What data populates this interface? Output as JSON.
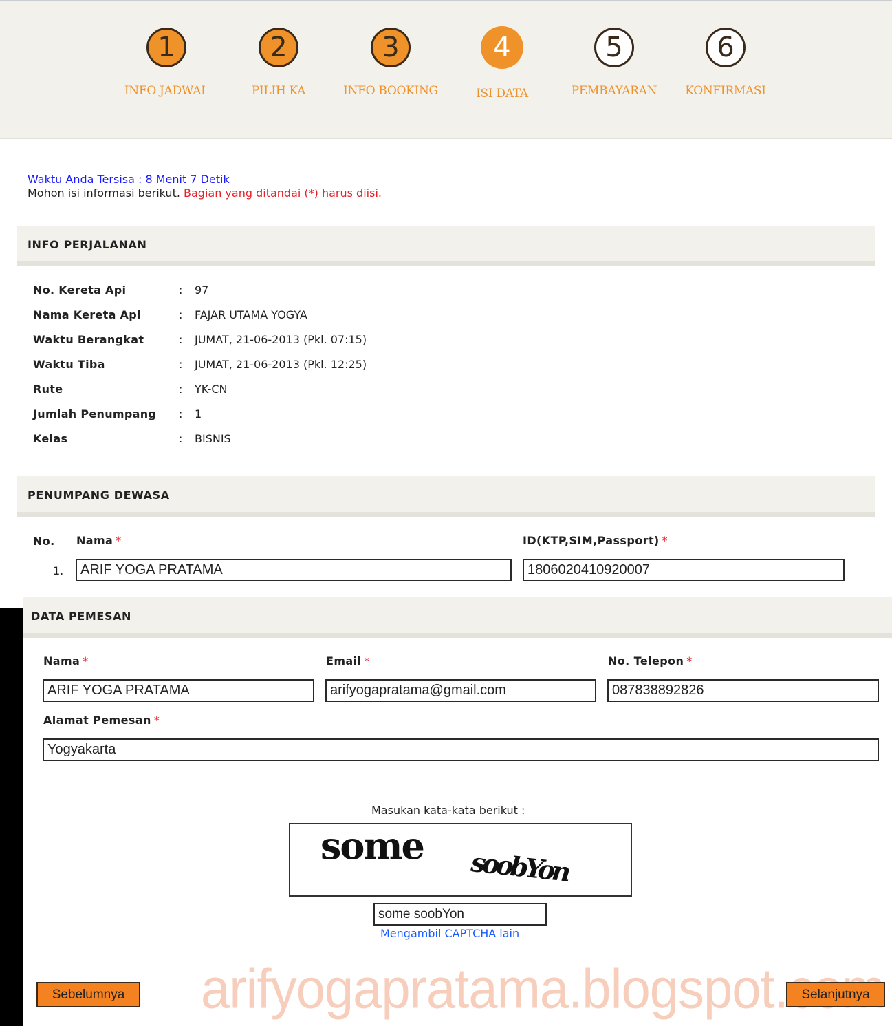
{
  "steps": [
    {
      "number": "1",
      "label": "INFO JADWAL",
      "state": "done"
    },
    {
      "number": "2",
      "label": "PILIH KA",
      "state": "done"
    },
    {
      "number": "3",
      "label": "INFO BOOKING",
      "state": "done"
    },
    {
      "number": "4",
      "label": "ISI DATA",
      "state": "active"
    },
    {
      "number": "5",
      "label": "PEMBAYARAN",
      "state": "todo"
    },
    {
      "number": "6",
      "label": "KONFIRMASI",
      "state": "todo"
    }
  ],
  "timer": "Waktu Anda Tersisa : 8 Menit 7 Detik",
  "notice": {
    "text": "Mohon isi informasi berikut. ",
    "required_text": "Bagian yang ditandai (*) harus diisi."
  },
  "trip_info": {
    "title": "INFO PERJALANAN",
    "rows": [
      {
        "label": "No. Kereta Api",
        "sep": ":",
        "value": "97"
      },
      {
        "label": "Nama Kereta Api",
        "sep": ":",
        "value": "FAJAR UTAMA YOGYA"
      },
      {
        "label": "Waktu Berangkat",
        "sep": ":",
        "value": "JUMAT, 21-06-2013 (Pkl. 07:15)"
      },
      {
        "label": "Waktu Tiba",
        "sep": ":",
        "value": "JUMAT, 21-06-2013 (Pkl. 12:25)"
      },
      {
        "label": "Rute",
        "sep": ":",
        "value": "YK-CN"
      },
      {
        "label": "Jumlah Penumpang",
        "sep": ":",
        "value": "1"
      },
      {
        "label": "Kelas",
        "sep": ":",
        "value": "BISNIS"
      }
    ]
  },
  "adult_passenger": {
    "title": "PENUMPANG DEWASA",
    "col_no": "No.",
    "col_name": "Nama",
    "col_id": "ID(KTP,SIM,Passport)",
    "required_mark": "*",
    "row_no": "1.",
    "name_value": "ARIF YOGA PRATAMA",
    "id_value": "1806020410920007"
  },
  "booker": {
    "title": "DATA PEMESAN",
    "name_label": "Nama",
    "email_label": "Email",
    "phone_label": "No. Telepon",
    "address_label": "Alamat Pemesan",
    "required_mark": "*",
    "name_value": "ARIF YOGA PRATAMA",
    "email_value": "arifyogapratama@gmail.com",
    "phone_value": "087838892826",
    "address_value": "Yogyakarta"
  },
  "captcha": {
    "label": "Masukan kata-kata berikut :",
    "word1": "some",
    "word2": "soobYon",
    "input_value": "some soobYon",
    "refresh_link": "Mengambil CAPTCHA lain"
  },
  "buttons": {
    "prev": "Sebelumnya",
    "next": "Selanjutnya"
  },
  "watermark": "arifyogapratama.blogspot.com",
  "colors": {
    "accent": "#f0922a",
    "required": "#e8202a",
    "link": "#1a5cff",
    "button": "#f58220"
  }
}
